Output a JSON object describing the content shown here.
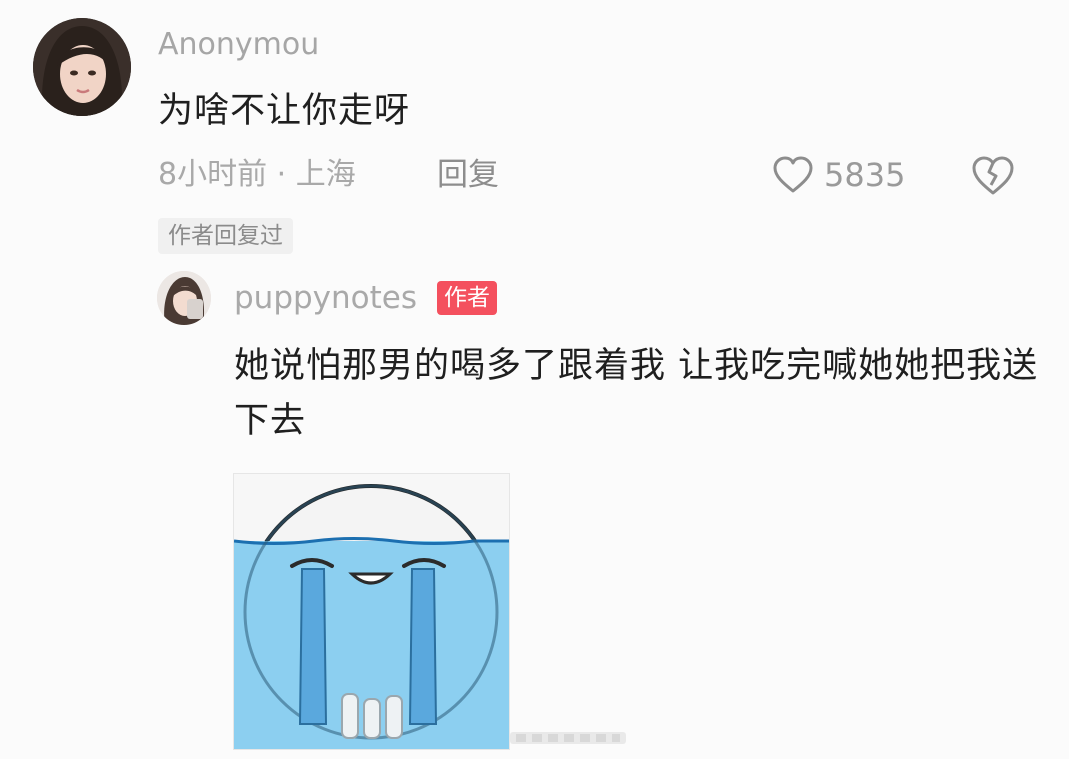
{
  "comment": {
    "username": "Anonymou",
    "text": "为啥不让你走呀",
    "meta": "8小时前 · 上海",
    "reply_label": "回复",
    "like_count": "5835",
    "author_replied_tag": "作者回复过",
    "icons": {
      "like": "heart-outline-icon",
      "dislike": "broken-heart-icon"
    }
  },
  "reply": {
    "username": "puppynotes",
    "badge": "作者",
    "text": "她说怕那男的喝多了跟着我 让我吃完喊她她把我送下去",
    "sticker": "crying-face-sticker"
  },
  "colors": {
    "badge": "#f4505e",
    "muted_text": "#a9a9a9",
    "body_text": "#1f1f1f",
    "sticker_water": "#8ccff0"
  }
}
